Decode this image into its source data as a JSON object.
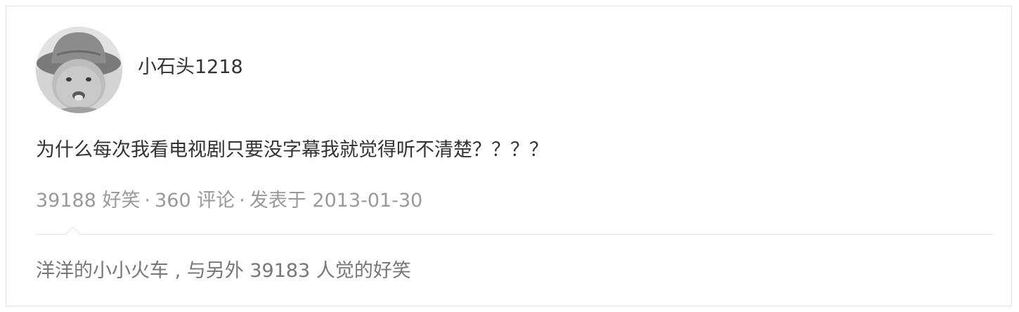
{
  "post": {
    "author": {
      "name": "小石头1218",
      "avatar_icon": "child-photo-avatar"
    },
    "text": "为什么每次我看电视剧只要没字幕我就觉得听不清楚？？？？",
    "stats": {
      "funny_count": "39188",
      "funny_label": "好笑",
      "comments_count": "360",
      "comments_label": "评论",
      "published_label": "发表于",
      "published_date": "2013-01-30",
      "separator": "·"
    },
    "liked_by": {
      "user": "洋洋的小小火车",
      "rest": " , 与另外 ",
      "others_count": "39183",
      "suffix": " 人觉的好笑"
    }
  },
  "colors": {
    "text_primary": "#333333",
    "text_meta": "#999999",
    "text_secondary": "#777777",
    "border": "#e1e1e1"
  }
}
